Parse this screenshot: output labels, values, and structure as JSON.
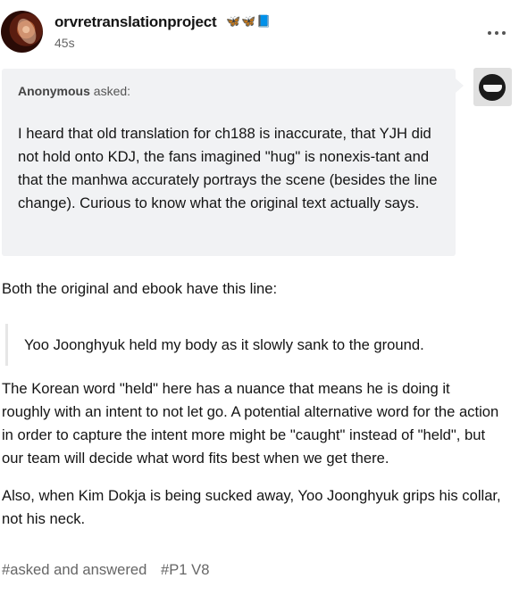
{
  "post": {
    "blog_name": "orvretranslationproject",
    "blog_emoji": "🦋🦋📘",
    "timestamp": "45s",
    "more_label": "•••"
  },
  "ask": {
    "asker": "Anonymous",
    "asked_label": " asked:",
    "question": "I heard that old translation for ch188 is inaccurate, that YJH did not hold onto KDJ, the fans imagined \"hug\" is nonexis-tant and that the manhwa accurately portrays the scene (besides the line change). Curious to know what the original text actually says."
  },
  "answer": {
    "intro": "Both the original and ebook have this line:",
    "quote": "Yoo Joonghyuk held my body as it slowly sank to the ground.",
    "paragraph_1": "The Korean word \"held\" here has a nuance that means he is doing it roughly with an intent to not let go. A potential alternative word for the action in order to capture the intent more might be \"caught\" instead of \"held\", but our team will decide what word fits best when we get there.",
    "paragraph_2": "Also, when Kim Dokja is being sucked away, Yoo Joonghyuk grips his collar, not his neck."
  },
  "tags": [
    "#asked and answered",
    "#P1 V8"
  ],
  "icons": {
    "avatar": "blog-avatar",
    "more": "more-options-icon",
    "anonymous": "anonymous-avatar-icon"
  },
  "colors": {
    "ask_background": "#f1f2f4",
    "text": "#141414",
    "muted": "#666666"
  }
}
